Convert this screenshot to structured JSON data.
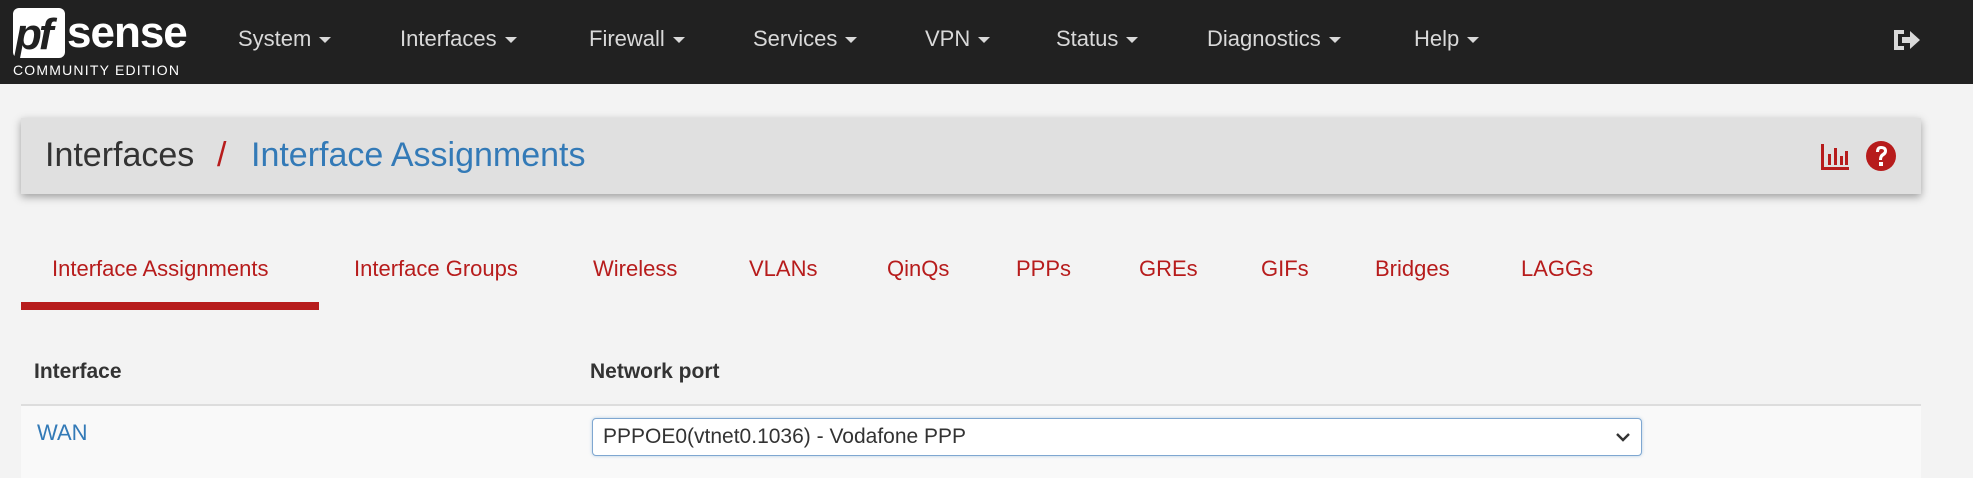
{
  "brand": {
    "pf": "pf",
    "sense": "sense",
    "edition": "COMMUNITY EDITION"
  },
  "nav": {
    "items": [
      {
        "label": "System"
      },
      {
        "label": "Interfaces"
      },
      {
        "label": "Firewall"
      },
      {
        "label": "Services"
      },
      {
        "label": "VPN"
      },
      {
        "label": "Status"
      },
      {
        "label": "Diagnostics"
      },
      {
        "label": "Help"
      }
    ],
    "logout_icon": "sign-out-icon"
  },
  "header": {
    "root": "Interfaces",
    "separator": "/",
    "current": "Interface Assignments",
    "icons": [
      "bar-chart-icon",
      "question-circle-icon"
    ]
  },
  "tabs": [
    {
      "label": "Interface Assignments",
      "active": true
    },
    {
      "label": "Interface Groups"
    },
    {
      "label": "Wireless"
    },
    {
      "label": "VLANs"
    },
    {
      "label": "QinQs"
    },
    {
      "label": "PPPs"
    },
    {
      "label": "GREs"
    },
    {
      "label": "GIFs"
    },
    {
      "label": "Bridges"
    },
    {
      "label": "LAGGs"
    }
  ],
  "table": {
    "columns": [
      "Interface",
      "Network port"
    ],
    "rows": [
      {
        "interface": "WAN",
        "network_port": "PPPOE0(vtnet0.1036) - Vodafone PPP"
      }
    ]
  },
  "colors": {
    "navbar": "#212121",
    "accent_red": "#b71c1c",
    "link_blue": "#337ab7"
  }
}
